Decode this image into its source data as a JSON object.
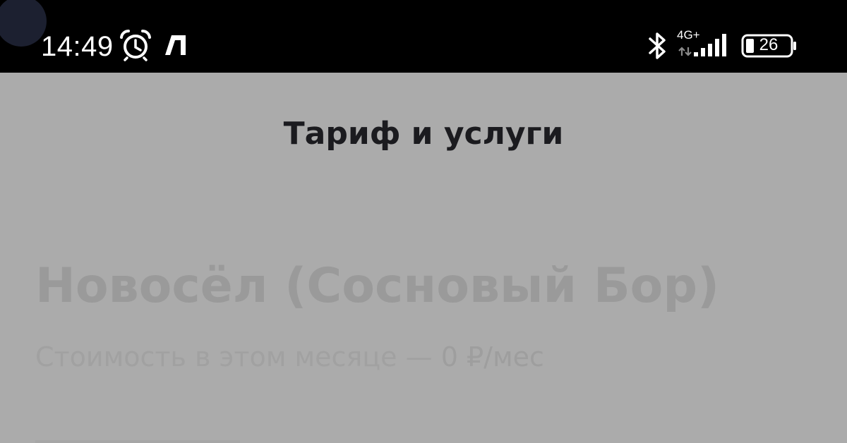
{
  "status_bar": {
    "time": "14:49",
    "network_type": "4G+",
    "battery_level": "26",
    "icons": [
      "alarm-icon",
      "carrier-icon",
      "bluetooth-icon",
      "data-transfer-icon",
      "signal-strength-icon",
      "battery-icon"
    ],
    "signal_bars": 5
  },
  "header": {
    "title": "Тариф и услуги"
  },
  "tariff": {
    "name": "Новосёл (Сосновый Бор)",
    "cost_text": "Стоимость в этом месяце — ",
    "cost_value": "0 ₽/мес"
  },
  "colors": {
    "status_bar_background": "#000000",
    "screen_background": "#ababab",
    "title_text": "#1b1b1f",
    "dimmed_text": "#9a9a9a"
  }
}
